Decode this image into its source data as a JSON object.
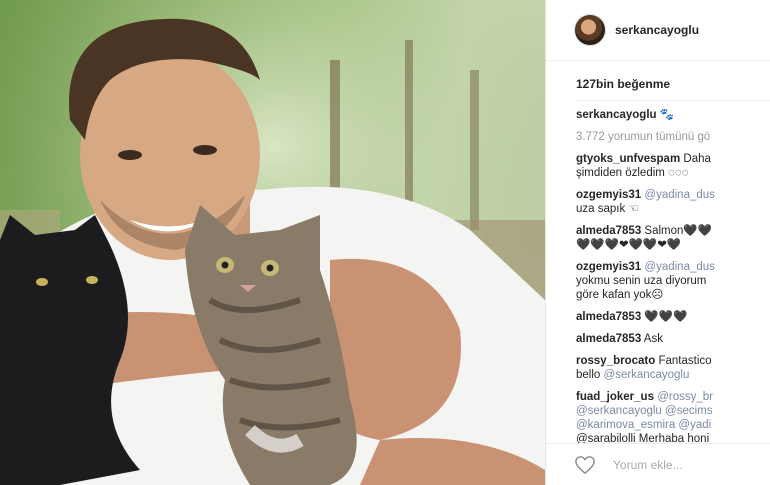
{
  "post": {
    "username": "serkancayoglu",
    "likes_text": "127bin beğenme",
    "caption_user": "serkancayoglu",
    "caption_text": "🐾",
    "view_all_text": "3.772 yorumun tümünü gö",
    "comments": [
      {
        "user": "gtyoks_unfvespam",
        "text": "Daha",
        "cont": "şimdiden özledim ◌◌◌"
      },
      {
        "user": "ozgemyis31",
        "mention": "@yadina_dus",
        "cont": "uza sapık ☜"
      },
      {
        "user": "almeda7853",
        "text": "Salmon🖤🖤",
        "cont": "🖤🖤🖤❤🖤🖤❤🖤"
      },
      {
        "user": "ozgemyis31",
        "mention": "@yadina_dus",
        "cont": "yokmu senin uza diyorum",
        "cont2": "göre kafan yok☹"
      },
      {
        "user": "almeda7853",
        "text": "🖤🖤🖤"
      },
      {
        "user": "almeda7853",
        "text": "Ask"
      },
      {
        "user": "rossy_brocato",
        "text": "Fantastico",
        "cont": "bello",
        "cont_mention": "@serkancayoglu"
      },
      {
        "user": "fuad_joker_us",
        "mention": "@rossy_br",
        "lines": [
          "@serkancayoglu @secims",
          "@karimova_esmira @yadi",
          "@sarabilolli Merhaba honi"
        ]
      }
    ],
    "comment_placeholder": "Yorum ekle...",
    "icons": {
      "avatar": "profile-avatar",
      "like": "heart-icon"
    },
    "colors": {
      "mention": "#7a8aa8",
      "muted": "#999999",
      "text": "#262626"
    }
  }
}
